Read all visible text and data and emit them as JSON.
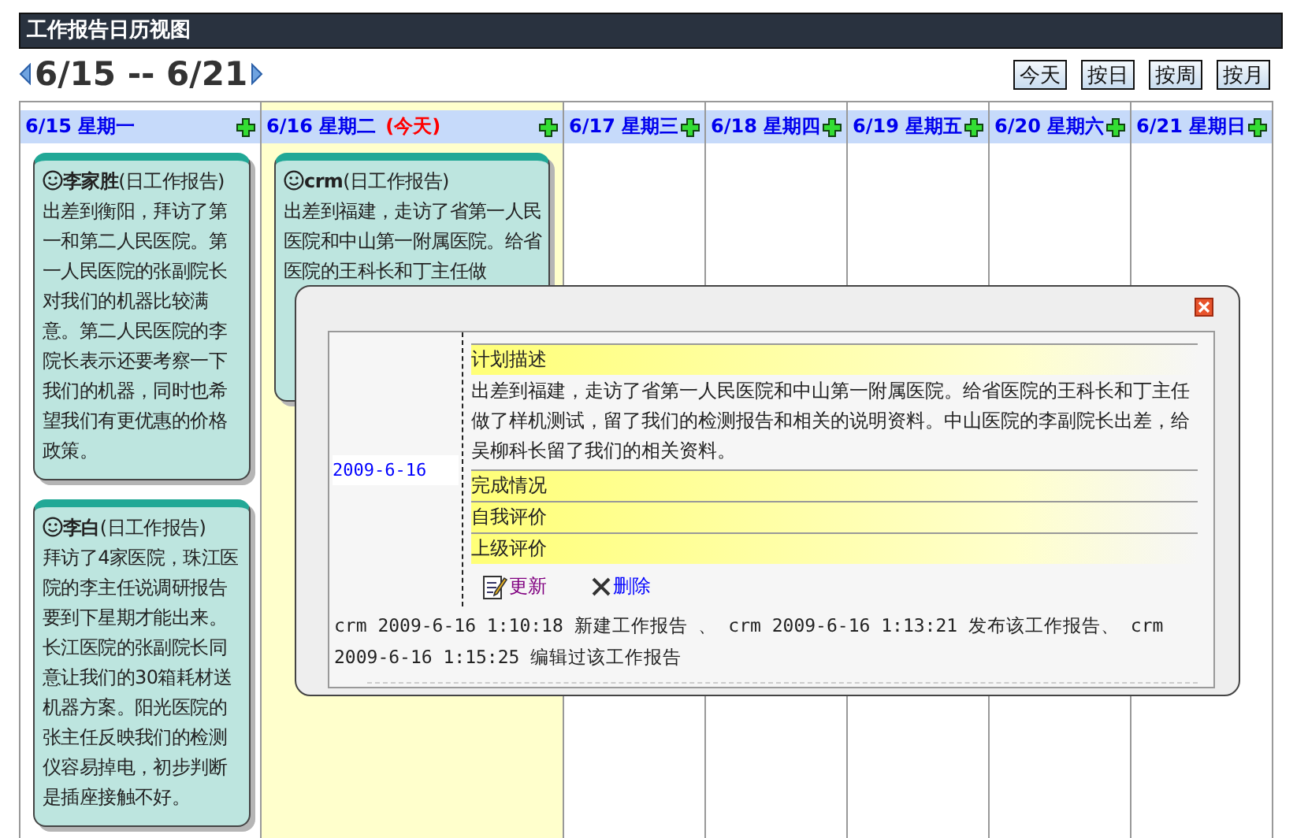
{
  "title": "工作报告日历视图",
  "range": "6/15 -- 6/21",
  "view_buttons": [
    "今天",
    "按日",
    "按周",
    "按月"
  ],
  "days": [
    {
      "date": "6/15 星期一",
      "today": false,
      "reports": [
        {
          "author": "李家胜",
          "type": "(日工作报告)",
          "body": "出差到衡阳，拜访了第一和第二人民医院。第一人民医院的张副院长对我们的机器比较满意。第二人民医院的李院长表示还要考察一下我们的机器，同时也希望我们有更优惠的价格政策。"
        },
        {
          "author": "李白",
          "type": "(日工作报告)",
          "body": "拜访了4家医院，珠江医院的李主任说调研报告要到下星期才能出来。长江医院的张副院长同意让我们的30箱耗材送机器方案。阳光医院的张主任反映我们的检测仪容易掉电，初步判断是插座接触不好。"
        }
      ]
    },
    {
      "date": "6/16 星期二",
      "today": true,
      "today_note": "(今天)",
      "reports": [
        {
          "author": "crm",
          "type": "(日工作报告)",
          "body": "出差到福建，走访了省第一人民医院和中山第一附属医院。给省医院的王科长和丁主任做"
        }
      ]
    },
    {
      "date": "6/17 星期三",
      "today": false
    },
    {
      "date": "6/18 星期四",
      "today": false
    },
    {
      "date": "6/19 星期五",
      "today": false
    },
    {
      "date": "6/20 星期六",
      "today": false
    },
    {
      "date": "6/21 星期日",
      "today": false
    }
  ],
  "popup": {
    "date": "2009-6-16",
    "sections": [
      {
        "heading": "计划描述",
        "body": "出差到福建，走访了省第一人民医院和中山第一附属医院。给省医院的王科长和丁主任做了样机测试，留了我们的检测报告和相关的说明资料。中山医院的李副院长出差，给吴柳科长留了我们的相关资料。"
      },
      {
        "heading": "完成情况"
      },
      {
        "heading": "自我评价"
      },
      {
        "heading": "上级评价"
      }
    ],
    "actions": [
      {
        "kind": "edit",
        "label": "更新"
      },
      {
        "kind": "delete",
        "label": "删除"
      }
    ],
    "log": "crm 2009-6-16 1:10:18 新建工作报告 、 crm 2009-6-16 1:13:21 发布该工作报告、 crm 2009-6-16 1:15:25 编辑过该工作报告"
  }
}
